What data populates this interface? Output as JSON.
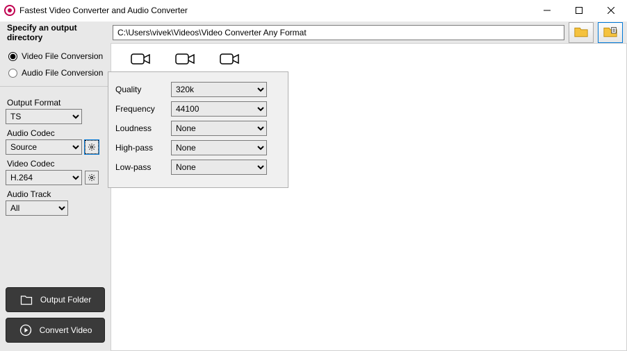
{
  "title": "Fastest Video Converter and Audio Converter",
  "toprow": {
    "label": "Specify an output directory",
    "path": "C:\\Users\\vivek\\Videos\\Video Converter Any Format"
  },
  "radios": {
    "video": "Video File Conversion",
    "audio": "Audio File Conversion"
  },
  "sidebar": {
    "outputFormatLabel": "Output Format",
    "outputFormat": "TS",
    "audioCodecLabel": "Audio Codec",
    "audioCodec": "Source",
    "videoCodecLabel": "Video Codec",
    "videoCodec": "H.264",
    "audioTrackLabel": "Audio Track",
    "audioTrack": "All"
  },
  "buttons": {
    "outputFolder": "Output Folder",
    "convertVideo": "Convert Video"
  },
  "popup": {
    "qualityLabel": "Quality",
    "quality": "320k",
    "frequencyLabel": "Frequency",
    "frequency": "44100",
    "loudnessLabel": "Loudness",
    "loudness": "None",
    "highpassLabel": "High-pass",
    "highpass": "None",
    "lowpassLabel": "Low-pass",
    "lowpass": "None"
  }
}
